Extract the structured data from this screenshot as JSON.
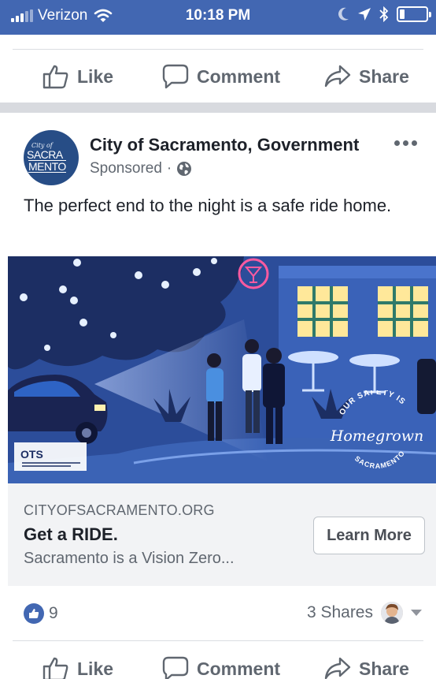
{
  "status_bar": {
    "carrier": "Verizon",
    "time": "10:18 PM",
    "icons": [
      "signal-icon",
      "wifi-icon",
      "moon-icon",
      "location-arrow-icon",
      "bluetooth-icon",
      "battery-icon"
    ],
    "battery_level": 0.2
  },
  "top_actions": {
    "like": "Like",
    "comment": "Comment",
    "share": "Share"
  },
  "post": {
    "page_name": "City of Sacramento, Government",
    "sponsored": "Sponsored",
    "separator": "·",
    "text": "The perfect end to the night is a safe ride home.",
    "avatar": {
      "city": "City of",
      "line1": "SACRA",
      "line2": "MENTO"
    },
    "image": {
      "badge_top": "OUR SAFETY IS",
      "badge_main": "Homegrown",
      "badge_bottom": "SACRAMENTO",
      "ots_logo": "OTS"
    },
    "link": {
      "domain": "CITYOFSACRAMENTO.ORG",
      "headline": "Get a RIDE.",
      "description": "Sacramento is a Vision Zero...",
      "cta": "Learn More"
    },
    "likes": "9",
    "shares": "3 Shares"
  },
  "bottom_actions": {
    "like": "Like",
    "comment": "Comment",
    "share": "Share"
  },
  "colors": {
    "status_bar": "#4267b2",
    "text_primary": "#1d2129",
    "text_secondary": "#606770",
    "link_card_bg": "#f2f3f5",
    "image_bg": "#2c4d9a"
  }
}
